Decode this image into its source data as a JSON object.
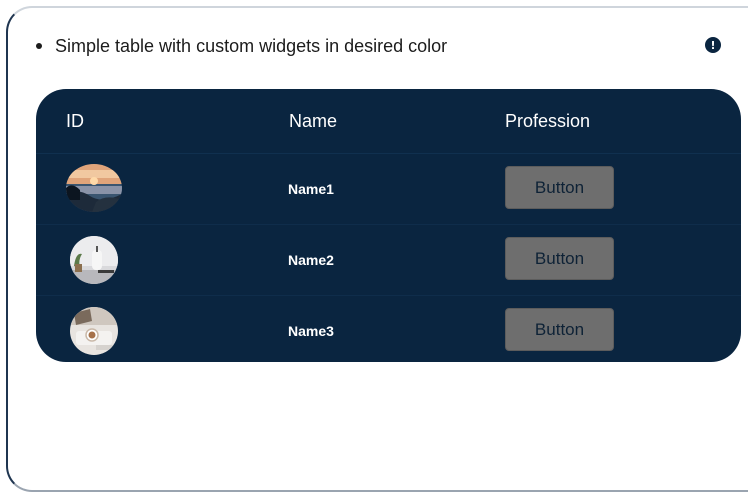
{
  "description": "Simple table with custom widgets in desired color",
  "table": {
    "columns": [
      "ID",
      "Name",
      "Profession"
    ],
    "rows": [
      {
        "avatar": "sunset-beach-photo",
        "name": "Name1",
        "button": "Button"
      },
      {
        "avatar": "white-vase-plant-photo",
        "name": "Name2",
        "button": "Button"
      },
      {
        "avatar": "coffee-desk-photo",
        "name": "Name3",
        "button": "Button"
      }
    ]
  },
  "colors": {
    "table_background": "#0a2540",
    "button_background": "#6e6e6e",
    "info_icon": "#0a2540"
  }
}
